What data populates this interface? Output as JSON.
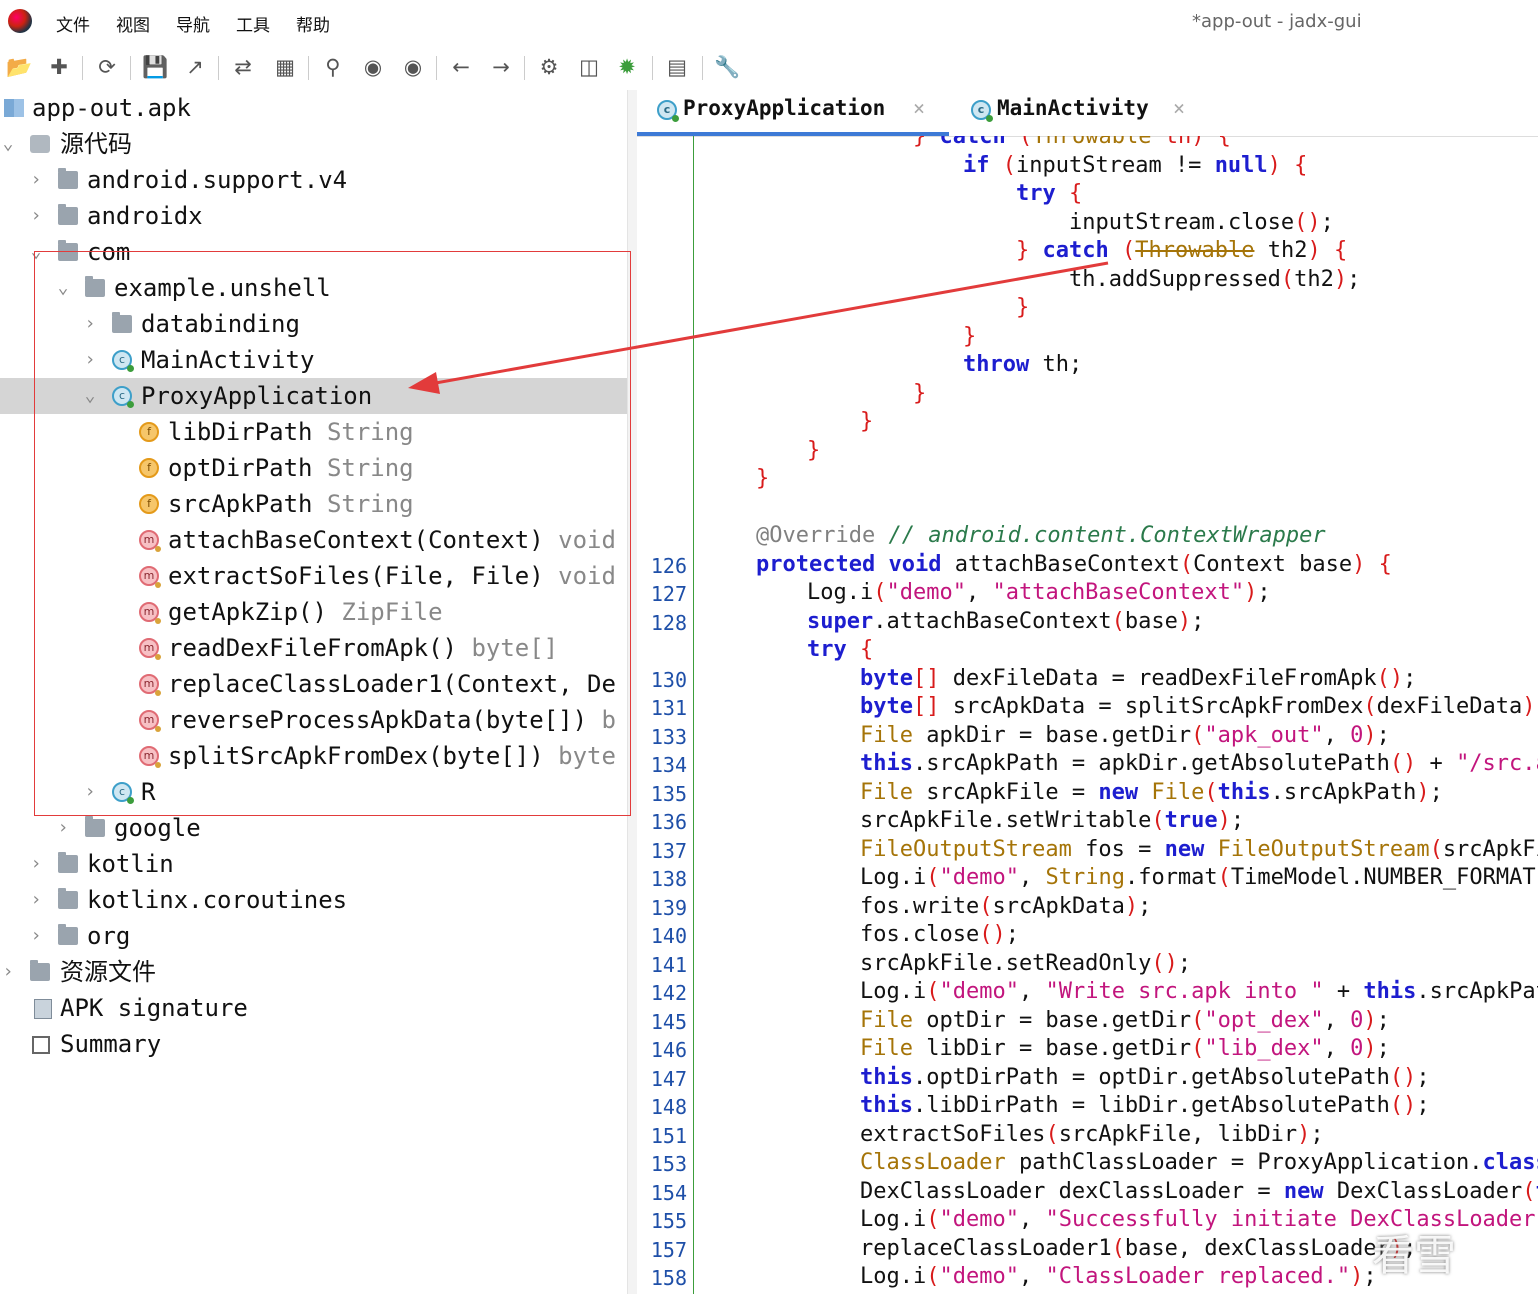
{
  "window": {
    "title": "*app-out - jadx-gui",
    "menu": [
      "文件",
      "视图",
      "导航",
      "工具",
      "帮助"
    ]
  },
  "toolbar": {
    "icons": [
      "open-folder-icon",
      "add-file-icon",
      "refresh-icon",
      "save-icon",
      "export-icon",
      "sync-tree-icon",
      "flatten-packages-icon",
      "search-icon",
      "find-class-icon",
      "find-usage-icon",
      "back-icon",
      "forward-icon",
      "decompile-all-icon",
      "deobfuscation-icon",
      "debugger-icon",
      "log-icon",
      "settings-icon"
    ]
  },
  "tree": {
    "root": "app-out.apk",
    "source_code": "源代码",
    "packages": {
      "android_support": "android.support.v4",
      "androidx": "androidx",
      "com": "com",
      "example_unshell": "example.unshell",
      "databinding": "databinding",
      "main_activity": "MainActivity",
      "proxy_application": "ProxyApplication",
      "r_class": "R",
      "google": "google",
      "kotlin": "kotlin",
      "kotlinx": "kotlinx.coroutines",
      "org": "org"
    },
    "members": [
      {
        "kind": "field",
        "name": "libDirPath",
        "type": "String"
      },
      {
        "kind": "field",
        "name": "optDirPath",
        "type": "String"
      },
      {
        "kind": "field",
        "name": "srcApkPath",
        "type": "String"
      },
      {
        "kind": "method",
        "name": "attachBaseContext(Context)",
        "type": "void"
      },
      {
        "kind": "method",
        "name": "extractSoFiles(File, File)",
        "type": "void"
      },
      {
        "kind": "method",
        "name": "getApkZip()",
        "type": "ZipFile"
      },
      {
        "kind": "method",
        "name": "readDexFileFromApk()",
        "type": "byte[]"
      },
      {
        "kind": "method",
        "name": "replaceClassLoader1(Context, De",
        "type": ""
      },
      {
        "kind": "method",
        "name": "reverseProcessApkData(byte[])",
        "type": "b"
      },
      {
        "kind": "method",
        "name": "splitSrcApkFromDex(byte[])",
        "type": "byte"
      }
    ],
    "resources": "资源文件",
    "apk_signature": "APK signature",
    "summary": "Summary"
  },
  "tabs": [
    {
      "label": "ProxyApplication",
      "active": true
    },
    {
      "label": "MainActivity",
      "active": false
    }
  ],
  "code": {
    "line_numbers": [
      "126",
      "127",
      "128",
      "130",
      "131",
      "133",
      "134",
      "135",
      "136",
      "137",
      "138",
      "139",
      "140",
      "141",
      "142",
      "145",
      "146",
      "147",
      "148",
      "151",
      "153",
      "154",
      "155",
      "157",
      "158"
    ]
  },
  "watermark": "看雪",
  "colors": {
    "keyword": "#1d1ecf",
    "string": "#c2157d",
    "type": "#a57408",
    "comment": "#2b7a4b",
    "bracket": "#d81b1b",
    "line_number": "#1e4fa8",
    "selection": "#d5d5d5",
    "annotation_box": "#e23b3b"
  }
}
